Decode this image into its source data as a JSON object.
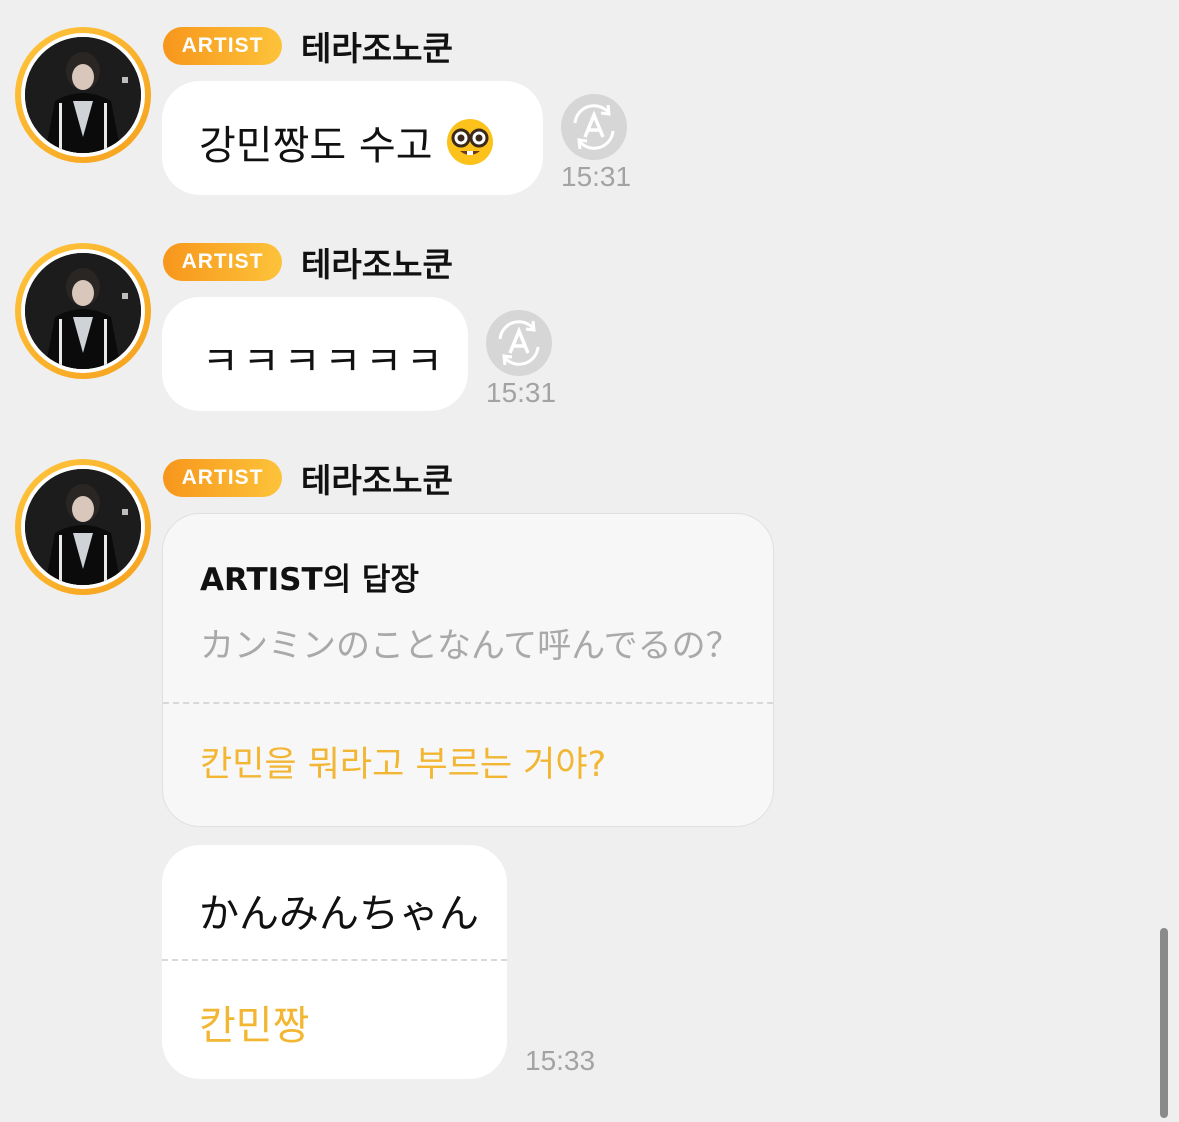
{
  "colors": {
    "background": "#efefef",
    "badge_gradient_start": "#f7961c",
    "badge_gradient_end": "#fdc33a",
    "avatar_ring": "#f5a11d",
    "translation_text": "#f2b632",
    "timestamp": "#a3a3a3",
    "bubble": "#ffffff"
  },
  "messages": [
    {
      "badge": "ARTIST",
      "sender": "테라조노쿤",
      "text": "강민짱도 수고",
      "emoji": "nerd-face-icon",
      "time": "15:31",
      "translate_icon": "auto-translate-icon"
    },
    {
      "badge": "ARTIST",
      "sender": "테라조노쿤",
      "text": "ㅋㅋㅋㅋㅋㅋ",
      "time": "15:31",
      "translate_icon": "auto-translate-icon"
    },
    {
      "badge": "ARTIST",
      "sender": "테라조노쿤",
      "reply": {
        "title": "ARTIST의 답장",
        "original": "カンミンのことなんて呼んでるの？",
        "translation": "칸민을 뭐라고 부르는 거야?"
      },
      "text": "かんみんちゃん",
      "translation": "칸민짱",
      "time": "15:33"
    }
  ]
}
